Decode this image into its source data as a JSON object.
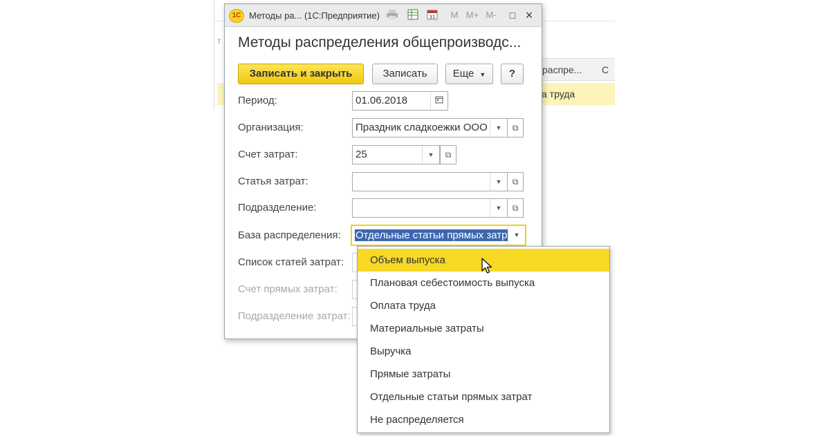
{
  "background": {
    "col_header_1": "распре...",
    "col_header_2": "С",
    "row_text": "а труда",
    "cut_label": "т"
  },
  "window": {
    "title": "Методы ра... (1С:Предприятие)",
    "toolbar_icons": [
      "print-icon",
      "spreadsheet-icon",
      "calendar-icon",
      "memory-icons"
    ],
    "memory_labels": [
      "M",
      "M+",
      "M-"
    ],
    "minimize": "□",
    "close": "×"
  },
  "form": {
    "title": "Методы распределения общепроизводс...",
    "buttons": {
      "save_close": "Записать и закрыть",
      "save": "Записать",
      "more": "Еще",
      "help": "?"
    },
    "fields": {
      "period_label": "Период:",
      "period_value": "01.06.2018",
      "org_label": "Организация:",
      "org_value": "Праздник сладкоежки ООО",
      "account_label": "Счет затрат:",
      "account_value": "25",
      "cost_item_label": "Статья затрат:",
      "cost_item_value": "",
      "division_label": "Подразделение:",
      "division_value": "",
      "base_label": "База распределения:",
      "base_value": "Отдельные статьи прямых затр",
      "cost_list_label": "Список статей затрат:",
      "direct_account_label": "Счет прямых затрат:",
      "cost_division_label": "Подразделение затрат:"
    }
  },
  "dropdown": {
    "items": [
      "Объем выпуска",
      "Плановая себестоимость выпуска",
      "Оплата труда",
      "Материальные затраты",
      "Выручка",
      "Прямые затраты",
      "Отдельные статьи прямых затрат",
      "Не распределяется"
    ],
    "highlighted_index": 0
  },
  "colors": {
    "accent_yellow": "#f6d826",
    "selection_blue": "#3d67b0",
    "row_highlight": "#fcf3b8"
  }
}
